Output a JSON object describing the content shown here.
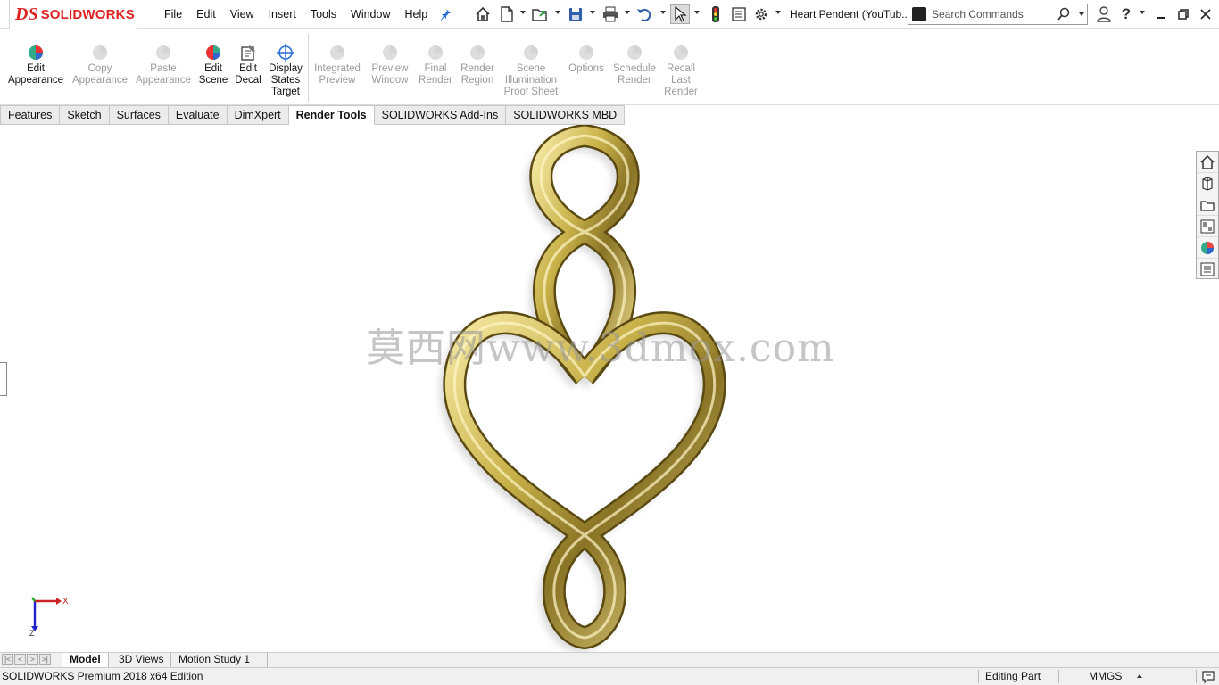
{
  "app": {
    "logo_ds": "DS",
    "logo_name": "SOLIDWORKS",
    "document_title": "Heart Pendent (YouTub..."
  },
  "menu": [
    "File",
    "Edit",
    "View",
    "Insert",
    "Tools",
    "Window",
    "Help"
  ],
  "search": {
    "placeholder": "Search Commands"
  },
  "toolbar_icons": [
    "home-icon",
    "new-document-icon",
    "open-icon",
    "save-icon",
    "print-icon",
    "undo-icon",
    "select-icon",
    "traffic-light-icon",
    "file-properties-icon",
    "options-gear-icon",
    "user-icon",
    "help-icon"
  ],
  "render_tools": [
    {
      "label": "Edit\nAppearance",
      "enabled": true,
      "icon": "edit-appearance-icon"
    },
    {
      "label": "Copy\nAppearance",
      "enabled": false,
      "icon": "copy-appearance-icon"
    },
    {
      "label": "Paste\nAppearance",
      "enabled": false,
      "icon": "paste-appearance-icon"
    },
    {
      "label": "Edit\nScene",
      "enabled": true,
      "icon": "edit-scene-icon"
    },
    {
      "label": "Edit\nDecal",
      "enabled": true,
      "icon": "edit-decal-icon"
    },
    {
      "label": "Display\nStates\nTarget",
      "enabled": true,
      "icon": "display-states-target-icon"
    },
    {
      "label": "Integrated\nPreview",
      "enabled": false,
      "icon": "integrated-preview-icon"
    },
    {
      "label": "Preview\nWindow",
      "enabled": false,
      "icon": "preview-window-icon"
    },
    {
      "label": "Final\nRender",
      "enabled": false,
      "icon": "final-render-icon"
    },
    {
      "label": "Render\nRegion",
      "enabled": false,
      "icon": "render-region-icon"
    },
    {
      "label": "Scene\nIllumination\nProof Sheet",
      "enabled": false,
      "icon": "scene-illumination-icon"
    },
    {
      "label": "Options",
      "enabled": false,
      "icon": "options-icon"
    },
    {
      "label": "Schedule\nRender",
      "enabled": false,
      "icon": "schedule-render-icon"
    },
    {
      "label": "Recall\nLast\nRender",
      "enabled": false,
      "icon": "recall-last-render-icon"
    }
  ],
  "tabs": [
    "Features",
    "Sketch",
    "Surfaces",
    "Evaluate",
    "DimXpert",
    "Render Tools",
    "SOLIDWORKS Add-Ins",
    "SOLIDWORKS MBD"
  ],
  "active_tab": "Render Tools",
  "viewport": {
    "watermark": "莫西网www.3dmox.com",
    "triad_x": "X",
    "triad_z": "Z",
    "model_color": "#c9b24a"
  },
  "task_pane": [
    "home-icon",
    "parts-library-icon",
    "file-explorer-icon",
    "view-palette-icon",
    "appearances-icon",
    "custom-properties-icon"
  ],
  "bottom_tabs": [
    "Model",
    "3D Views",
    "Motion Study 1"
  ],
  "status": {
    "left": "SOLIDWORKS Premium 2018 x64 Edition",
    "mode": "Editing Part",
    "units": "MMGS"
  }
}
